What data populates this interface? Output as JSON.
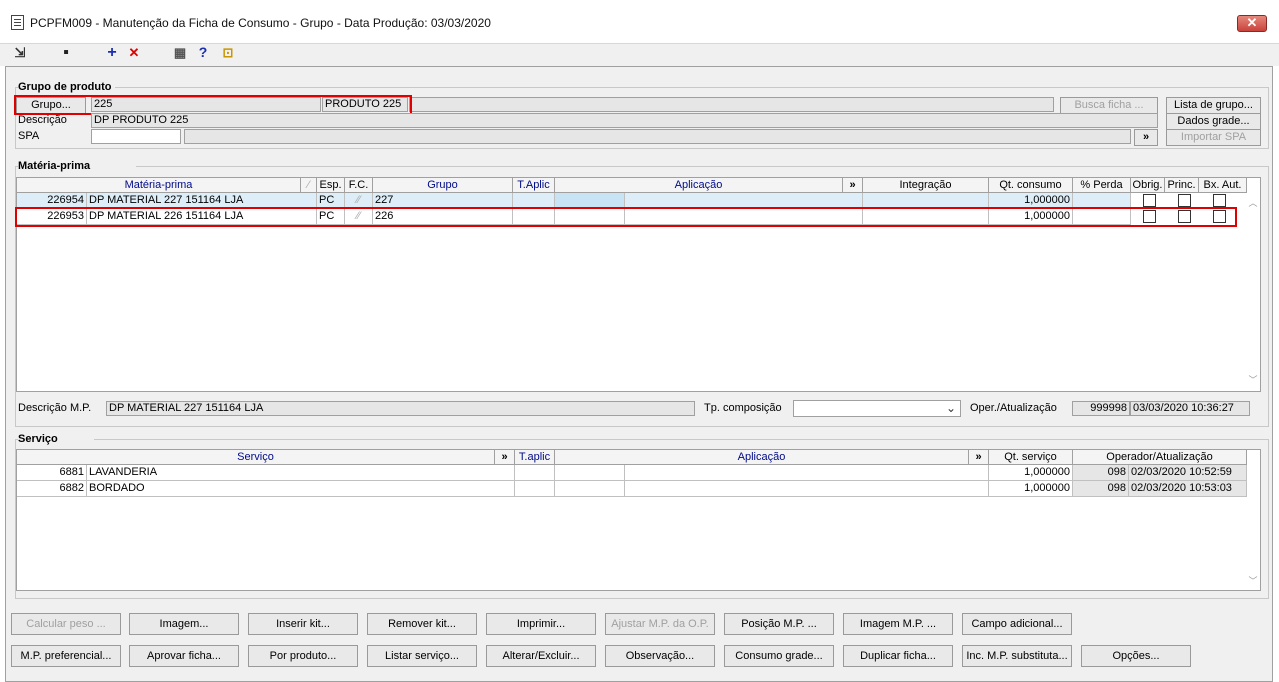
{
  "window": {
    "title": "PCPFM009 - Manutenção da Ficha de Consumo - Grupo - Data Produção: 03/03/2020",
    "close": "✕"
  },
  "toolbar": {
    "exit_glyph": "⇲",
    "save_glyph": "▪",
    "add_glyph": "+",
    "delete_glyph": "✕",
    "calc_glyph": "▦",
    "help_glyph": "?",
    "door_glyph": "⊡"
  },
  "grupo": {
    "section_title": "Grupo de produto",
    "grupo_button": "Grupo...",
    "grupo_code": "225",
    "grupo_name": "PRODUTO 225",
    "busca_ficha": "Busca ficha ...",
    "lista_grupo": "Lista de grupo...",
    "descricao_label": "Descrição",
    "descricao_value": "DP PRODUTO 225",
    "dados_grade": "Dados grade...",
    "spa_label": "SPA",
    "spa_value": "",
    "spa_more": "»",
    "importar_spa": "Importar SPA"
  },
  "materia": {
    "section_title": "Matéria-prima",
    "headers": {
      "materia": "Matéria-prima",
      "esp": "Esp.",
      "fc": "F.C.",
      "grupo": "Grupo",
      "taplic": "T.Aplic",
      "aplicacao": "Aplicação",
      "more": "»",
      "integracao": "Integração",
      "qt": "Qt. consumo",
      "perda": "% Perda",
      "obrig": "Obrig.",
      "princ": "Princ.",
      "bxaut": "Bx. Aut."
    },
    "rows": [
      {
        "code": "226954",
        "name": "DP MATERIAL 227 151164 LJA",
        "esp": "PC",
        "grupo": "227",
        "qt": "1,000000"
      },
      {
        "code": "226953",
        "name": "DP MATERIAL 226 151164 LJA",
        "esp": "PC",
        "grupo": "226",
        "qt": "1,000000"
      }
    ],
    "desc_label": "Descrição M.P.",
    "desc_value": "DP MATERIAL 227 151164 LJA",
    "tp_label": "Tp. composição",
    "tp_value": "",
    "oper_label": "Oper./Atualização",
    "oper_user": "999998",
    "oper_date": "03/03/2020 10:36:27"
  },
  "servico": {
    "section_title": "Serviço",
    "headers": {
      "servico": "Serviço",
      "more": "»",
      "taplic": "T.aplic",
      "aplicacao": "Aplicação",
      "more2": "»",
      "qt": "Qt. serviço",
      "oper": "Operador/Atualização"
    },
    "rows": [
      {
        "code": "6881",
        "name": "LAVANDERIA",
        "qt": "1,000000",
        "oper": "098",
        "date": "02/03/2020 10:52:59"
      },
      {
        "code": "6882",
        "name": "BORDADO",
        "qt": "1,000000",
        "oper": "098",
        "date": "02/03/2020 10:53:03"
      }
    ]
  },
  "buttons_row1": [
    "Calcular peso ...",
    "Imagem...",
    "Inserir kit...",
    "Remover kit...",
    "Imprimir...",
    "Ajustar M.P. da O.P.",
    "Posição M.P. ...",
    "Imagem M.P. ...",
    "Campo adicional..."
  ],
  "buttons_row2": [
    "M.P. preferencial...",
    "Aprovar ficha...",
    "Por produto...",
    "Listar serviço...",
    "Alterar/Excluir...",
    "Observação...",
    "Consumo grade...",
    "Duplicar ficha...",
    "Inc. M.P. substituta...",
    "Opções..."
  ]
}
